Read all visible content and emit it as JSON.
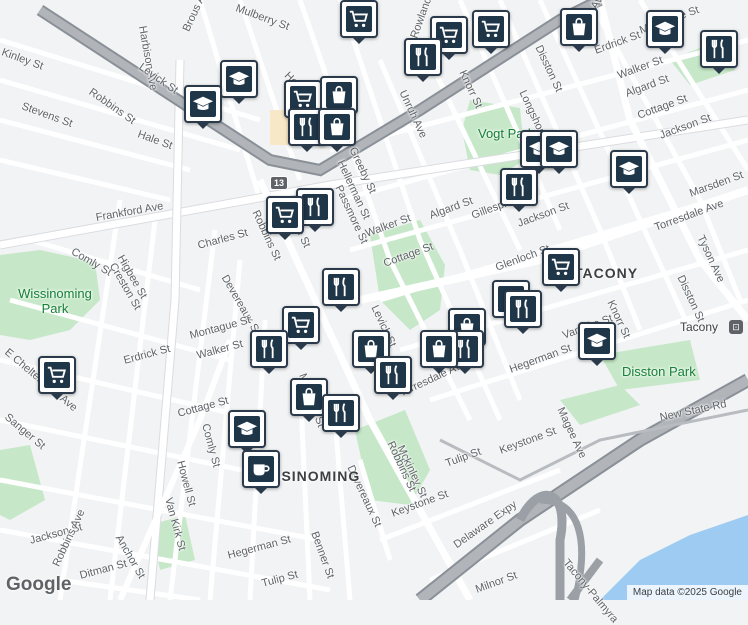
{
  "map": {
    "area_labels": [
      "TACONY",
      "WISSINOMING"
    ],
    "parks": [
      "Wissinoming Park",
      "Vogt Park",
      "Disston Park"
    ],
    "places": [
      "Tacony"
    ],
    "highway_shield": "13",
    "street_labels": [
      "Kinley St",
      "Stevens St",
      "Hale St",
      "Harbison Ave",
      "Brous Ave",
      "Levick St",
      "Robbins St",
      "Frankford Ave",
      "Comly St",
      "Higbee St",
      "Creston St",
      "Charles St",
      "Devereaux St",
      "Montague St",
      "Walker St",
      "Erdrick St",
      "Cottage St",
      "Howell St",
      "Van Kirk St",
      "Comly St",
      "Mckinley St",
      "Benner St",
      "Hegerman St",
      "Tulip St",
      "Ditman St",
      "Anchor St",
      "Jackson St",
      "Sanger St",
      "E Cheltenham Ave",
      "Robbins Ave",
      "Passmore St",
      "Greeby St",
      "Hellerman St",
      "Walker St",
      "Algard St",
      "Gillespie St",
      "Cottage St",
      "Jackson St",
      "Glenloch St",
      "Torresdale Ave",
      "Vandike St",
      "Hegerman St",
      "Keystone St",
      "Tulip St",
      "Unruh Ave",
      "Knorr St",
      "Disston St",
      "Tyson Ave",
      "Longshore Ave",
      "Erdrick St",
      "Montague St",
      "Walker St",
      "Algard St",
      "Cottage St",
      "Jackson St",
      "Marsden St",
      "Torresdale Ave",
      "Tyson Ave",
      "Disston St",
      "Knorr St",
      "Magee Ave",
      "New State Rd",
      "Delaware Expy",
      "Milnor St",
      "Tacony-Palmyra",
      "Keystone St",
      "Devereaux St",
      "Benner St",
      "Mckinley St",
      "Gillespie St",
      "Hellerman St",
      "Levick St",
      "Robbins St",
      "Walker St",
      "Cottage St",
      "Tulip St",
      "Hegerman St",
      "Ditman St",
      "Jackson St",
      "Cottage St",
      "Rowland Ave",
      "Bridge St",
      "Mulberry St",
      "Charles St"
    ],
    "markers": [
      {
        "type": "shopping-cart",
        "label": "grocery"
      },
      {
        "type": "shopping-cart",
        "label": "grocery"
      },
      {
        "type": "shopping-cart",
        "label": "grocery"
      },
      {
        "type": "graduation-cap",
        "label": "school"
      },
      {
        "type": "graduation-cap",
        "label": "school"
      },
      {
        "type": "shopping-cart",
        "label": "grocery"
      },
      {
        "type": "shopping-bag",
        "label": "store"
      },
      {
        "type": "utensils",
        "label": "restaurant"
      },
      {
        "type": "shopping-bag",
        "label": "store"
      },
      {
        "type": "utensils",
        "label": "restaurant"
      },
      {
        "type": "graduation-cap",
        "label": "school"
      },
      {
        "type": "graduation-cap",
        "label": "school"
      },
      {
        "type": "graduation-cap",
        "label": "school"
      },
      {
        "type": "utensils",
        "label": "restaurant"
      },
      {
        "type": "shopping-cart",
        "label": "grocery"
      },
      {
        "type": "utensils",
        "label": "restaurant"
      },
      {
        "type": "shopping-bag",
        "label": "store"
      },
      {
        "type": "shopping-bag",
        "label": "store"
      },
      {
        "type": "shopping-cart",
        "label": "grocery"
      },
      {
        "type": "utensils",
        "label": "restaurant"
      },
      {
        "type": "utensils",
        "label": "restaurant"
      },
      {
        "type": "shopping-bag",
        "label": "store"
      },
      {
        "type": "utensils",
        "label": "restaurant"
      },
      {
        "type": "shopping-bag",
        "label": "store"
      },
      {
        "type": "utensils",
        "label": "restaurant"
      },
      {
        "type": "graduation-cap",
        "label": "school"
      },
      {
        "type": "shopping-bag",
        "label": "store"
      },
      {
        "type": "utensils",
        "label": "restaurant"
      },
      {
        "type": "graduation-cap",
        "label": "school"
      },
      {
        "type": "shopping-cart",
        "label": "grocery"
      },
      {
        "type": "coffee-cup",
        "label": "cafe"
      },
      {
        "type": "shopping-cart",
        "label": "grocery"
      },
      {
        "type": "utensils",
        "label": "restaurant"
      },
      {
        "type": "shopping-bag",
        "label": "store"
      },
      {
        "type": "utensils",
        "label": "restaurant"
      },
      {
        "type": "graduation-cap",
        "label": "school"
      }
    ],
    "attribution": "Map data ©2025 Google",
    "logo": "Google",
    "colors": {
      "background": "#f1f3f4",
      "park": "#c8e6c9",
      "water": "#9ecbf2",
      "highway": "#9aa0a6",
      "major_road": "#ffffff",
      "marker_fill": "#1f3548"
    }
  }
}
